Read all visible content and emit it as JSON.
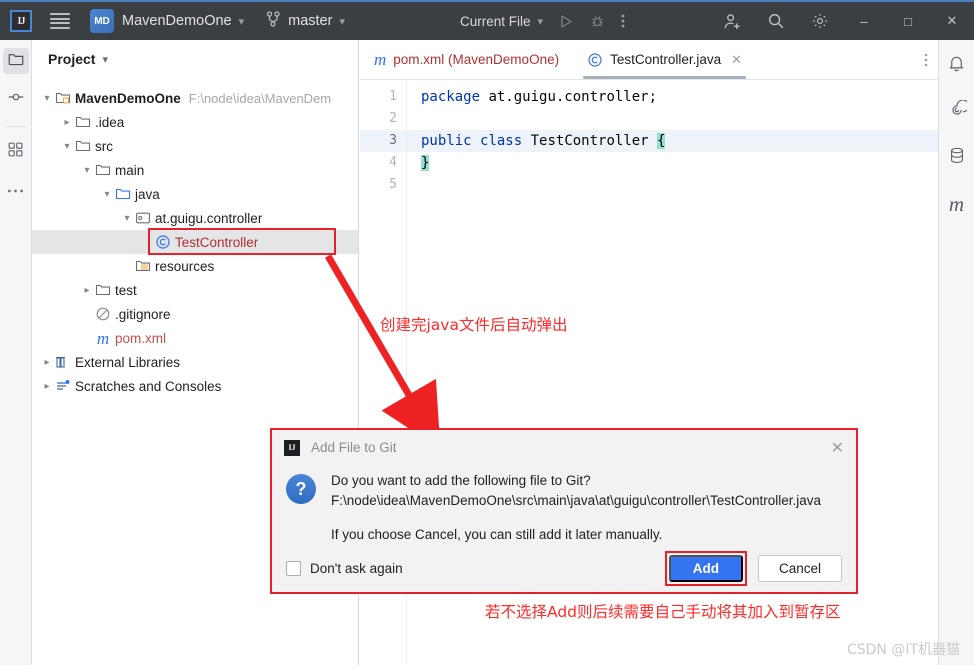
{
  "titlebar": {
    "ide_logo": "IJ",
    "menu_icon": "hamburger-menu-icon",
    "project_badge": "MD",
    "project_name": "MavenDemoOne",
    "branch_icon": "git-branch-icon",
    "branch_name": "master",
    "run_config": "Current File",
    "run_icon": "run-play-icon",
    "debug_icon": "debug-bug-icon",
    "more_icon": "more-vertical-icon",
    "account_icon": "add-user-icon",
    "search_icon": "search-icon",
    "settings_icon": "gear-icon",
    "minimize": "–",
    "maximize": "□",
    "close": "✕"
  },
  "left_strip": {
    "items": [
      {
        "name": "project-tool-window",
        "icon": "folder-icon",
        "active": true
      },
      {
        "name": "commit-tool-window",
        "icon": "commit-icon",
        "active": false
      },
      {
        "name": "structure-tool-window",
        "icon": "structure-grid-icon",
        "active": false
      },
      {
        "name": "more-tool-windows",
        "icon": "more-horizontal-icon",
        "active": false
      }
    ]
  },
  "right_strip": {
    "items": [
      {
        "name": "notifications",
        "icon": "bell-icon"
      },
      {
        "name": "ai-assistant",
        "icon": "spiral-icon"
      },
      {
        "name": "database",
        "icon": "database-icon"
      },
      {
        "name": "maven",
        "icon": "maven-m-icon"
      }
    ]
  },
  "project_panel": {
    "title": "Project",
    "tree": [
      {
        "label": "MavenDemoOne",
        "path": "F:\\node\\idea\\MavenDem",
        "icon": "module-icon",
        "arrow": "down",
        "indent": 0,
        "bold": true,
        "selected": false,
        "color": "normal"
      },
      {
        "label": ".idea",
        "path": "",
        "icon": "folder-icon",
        "arrow": "right",
        "indent": 1,
        "bold": false,
        "selected": false,
        "color": "normal"
      },
      {
        "label": "src",
        "path": "",
        "icon": "folder-icon",
        "arrow": "down",
        "indent": 1,
        "bold": false,
        "selected": false,
        "color": "normal"
      },
      {
        "label": "main",
        "path": "",
        "icon": "folder-icon",
        "arrow": "down",
        "indent": 2,
        "bold": false,
        "selected": false,
        "color": "normal"
      },
      {
        "label": "java",
        "path": "",
        "icon": "source-folder-icon",
        "arrow": "down",
        "indent": 3,
        "bold": false,
        "selected": false,
        "color": "normal"
      },
      {
        "label": "at.guigu.controller",
        "path": "",
        "icon": "package-icon",
        "arrow": "down",
        "indent": 4,
        "bold": false,
        "selected": false,
        "color": "normal"
      },
      {
        "label": "TestController",
        "path": "",
        "icon": "java-class-icon",
        "arrow": "none",
        "indent": 5,
        "bold": false,
        "selected": true,
        "color": "red"
      },
      {
        "label": "resources",
        "path": "",
        "icon": "resources-folder-icon",
        "arrow": "none",
        "indent": 4,
        "bold": false,
        "selected": false,
        "color": "normal"
      },
      {
        "label": "test",
        "path": "",
        "icon": "folder-icon",
        "arrow": "right",
        "indent": 2,
        "bold": false,
        "selected": false,
        "color": "normal"
      },
      {
        "label": ".gitignore",
        "path": "",
        "icon": "gitignore-icon",
        "arrow": "none",
        "indent": 2,
        "bold": false,
        "selected": false,
        "color": "normal"
      },
      {
        "label": "pom.xml",
        "path": "",
        "icon": "maven-m-icon",
        "arrow": "none",
        "indent": 2,
        "bold": false,
        "selected": false,
        "color": "pink"
      },
      {
        "label": "External Libraries",
        "path": "",
        "icon": "libraries-icon",
        "arrow": "right",
        "indent": 0,
        "bold": false,
        "selected": false,
        "color": "normal"
      },
      {
        "label": "Scratches and Consoles",
        "path": "",
        "icon": "scratches-icon",
        "arrow": "right",
        "indent": 0,
        "bold": false,
        "selected": false,
        "color": "normal"
      }
    ]
  },
  "editor": {
    "tabs": [
      {
        "label": "pom.xml (MavenDemoOne)",
        "icon": "maven-m-icon",
        "active": false,
        "closable": false
      },
      {
        "label": "TestController.java",
        "icon": "java-class-icon",
        "active": true,
        "closable": true
      }
    ],
    "tab_more_icon": "more-vertical-icon",
    "close_glyph": "✕",
    "line_numbers": [
      "1",
      "2",
      "3",
      "4",
      "5"
    ],
    "current_line": 3,
    "code": [
      {
        "n": 1,
        "tokens": [
          {
            "t": "package",
            "k": "kw"
          },
          {
            "t": " at.guigu.controller;",
            "k": "plain"
          }
        ]
      },
      {
        "n": 2,
        "tokens": []
      },
      {
        "n": 3,
        "tokens": [
          {
            "t": "public",
            "k": "kw"
          },
          {
            "t": " ",
            "k": "plain"
          },
          {
            "t": "class",
            "k": "kw"
          },
          {
            "t": " TestController ",
            "k": "plain"
          },
          {
            "t": "{",
            "k": "brmatch"
          }
        ]
      },
      {
        "n": 4,
        "tokens": [
          {
            "t": "}",
            "k": "brmatch"
          }
        ]
      },
      {
        "n": 5,
        "tokens": []
      }
    ]
  },
  "annotations": {
    "note_top": "创建完java文件后自动弹出",
    "note_bottom": "若不选择Add则后续需要自己手动将其加入到暂存区",
    "highlight_color": "#e8202a",
    "arrow_color": "#ee2222"
  },
  "dialog": {
    "logo": "IJ",
    "title": "Add File to Git",
    "close_glyph": "✕",
    "question_glyph": "?",
    "message_line1": "Do you want to add the following file to Git?",
    "message_line2": "F:\\node\\idea\\MavenDemoOne\\src\\main\\java\\at\\guigu\\controller\\TestController.java",
    "message_line3": "If you choose Cancel, you can still add it later manually.",
    "checkbox_label": "Don't ask again",
    "checkbox_checked": false,
    "add_label": "Add",
    "cancel_label": "Cancel",
    "add_color": "#3574f0"
  },
  "watermark": "CSDN @IT机器猫"
}
